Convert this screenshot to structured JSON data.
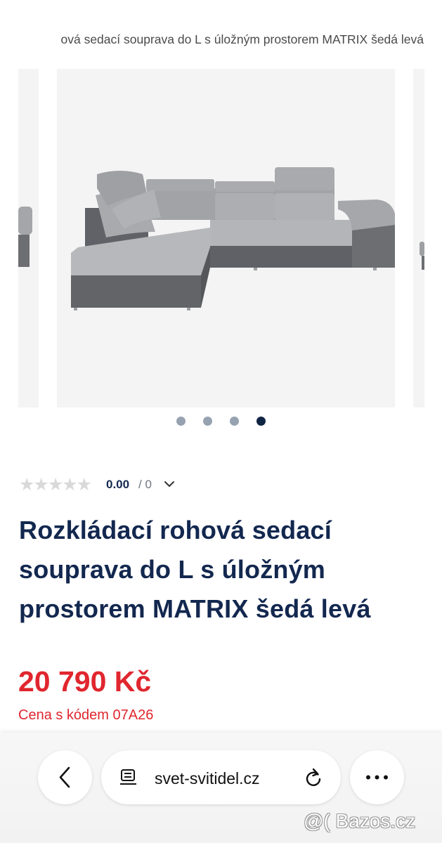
{
  "breadcrumb": {
    "text": "ová sedací souprava do L s úložným prostorem MATRIX šedá levá"
  },
  "gallery": {
    "images": [
      "sofa-image-1",
      "sofa-image-4",
      "sofa-image-next"
    ],
    "dots_total": 4,
    "active_dot": 4
  },
  "rating": {
    "stars_glyph": "★★★★★",
    "stars_filled": 0,
    "score": "0.00",
    "count_text": "/ 0"
  },
  "product": {
    "title_lines": [
      "Rozkládací rohová sedací",
      "souprava do L s úložným",
      "prostorem MATRIX šedá levá"
    ],
    "price": "20 790 Kč",
    "promo": "Cena s kódem 07A26"
  },
  "browser": {
    "url": "svet-svitidel.cz",
    "back_icon": "chevron-left-icon",
    "page_icon": "page-settings-icon",
    "reload_icon": "reload-icon",
    "more_icon": "more-horizontal-icon"
  },
  "watermark": {
    "text": "@( Bazos.cz"
  },
  "colors": {
    "accent_red": "#e0262e",
    "navy": "#13284f",
    "dot_inactive": "#97a2b1"
  }
}
